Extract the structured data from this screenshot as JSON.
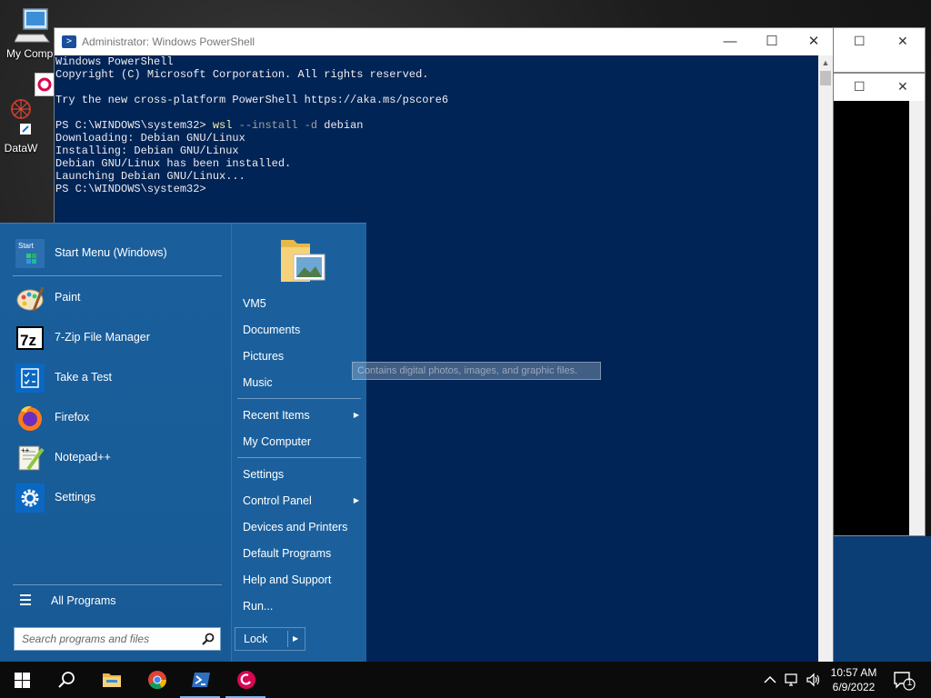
{
  "desktop": {
    "icons": [
      {
        "label": "My Compu"
      },
      {
        "label": "DataW"
      }
    ]
  },
  "powershell": {
    "title": "Administrator: Windows PowerShell",
    "lines": [
      "Windows PowerShell",
      "Copyright (C) Microsoft Corporation. All rights reserved.",
      "",
      "Try the new cross-platform PowerShell https://aka.ms/pscore6",
      ""
    ],
    "command": {
      "prompt": "PS C:\\WINDOWS\\system32> ",
      "verb": "wsl",
      "args": " --install -d ",
      "target": "debian"
    },
    "output": [
      "Downloading: Debian GNU/Linux",
      "Installing: Debian GNU/Linux",
      "Debian GNU/Linux has been installed.",
      "Launching Debian GNU/Linux...",
      "PS C:\\WINDOWS\\system32>"
    ]
  },
  "start_menu": {
    "pinned": [
      {
        "label": "Start Menu (Windows)",
        "icon": "start-menu-icon"
      },
      {
        "label": "Paint",
        "icon": "paint-icon"
      },
      {
        "label": "7-Zip File Manager",
        "icon": "7zip-icon"
      },
      {
        "label": "Take a Test",
        "icon": "take-a-test-icon"
      },
      {
        "label": "Firefox",
        "icon": "firefox-icon"
      },
      {
        "label": "Notepad++",
        "icon": "notepadpp-icon"
      },
      {
        "label": "Settings",
        "icon": "settings-gear-icon"
      }
    ],
    "start_icon_text": "Start",
    "all_programs": "All Programs",
    "search_placeholder": "Search programs and files",
    "right": [
      {
        "label": "VM5"
      },
      {
        "label": "Documents"
      },
      {
        "label": "Pictures"
      },
      {
        "label": "Music"
      },
      {
        "label": "Recent Items",
        "arrow": "▶"
      },
      {
        "label": "My Computer"
      },
      {
        "label": "Settings"
      },
      {
        "label": "Control Panel",
        "arrow": "▶"
      },
      {
        "label": "Devices and Printers"
      },
      {
        "label": "Default Programs"
      },
      {
        "label": "Help and Support"
      },
      {
        "label": "Run..."
      }
    ],
    "lock_label": "Lock",
    "lock_arrow": "▶",
    "tooltip": "Contains digital photos, images, and graphic files."
  },
  "taskbar": {
    "time": "10:57 AM",
    "date": "6/9/2022",
    "notification_count": "1"
  },
  "colors": {
    "ps_bg": "#012456",
    "start_bg": "#1a5f9c",
    "taskbar_bg": "#0b0b0b",
    "accent": "#76b9ed"
  }
}
